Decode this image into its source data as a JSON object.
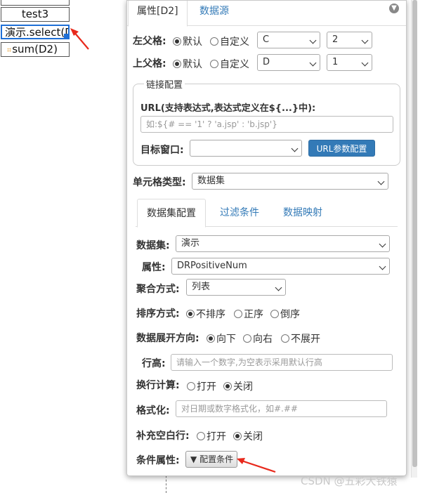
{
  "sheet": {
    "cells": [
      "test3",
      "演示.select(D",
      "sum(D2)"
    ],
    "sum_icon": "⌗"
  },
  "panel": {
    "tabs": [
      "属性[D2]",
      "数据源"
    ],
    "left_parent": {
      "label": "左父格:",
      "options": [
        "默认",
        "自定义"
      ],
      "selected": "默认",
      "col_value": "C",
      "row_value": "2"
    },
    "top_parent": {
      "label": "上父格:",
      "options": [
        "默认",
        "自定义"
      ],
      "selected": "默认",
      "col_value": "D",
      "row_value": "1"
    },
    "link": {
      "legend": "链接配置",
      "url_label": "URL(支持表达式,表达式定义在${...}中):",
      "url_placeholder": "如:${# == '1' ? 'a.jsp' : 'b.jsp'}",
      "target_label": "目标窗口:",
      "target_value": "",
      "param_button": "URL参数配置"
    },
    "cell_type": {
      "label": "单元格类型:",
      "value": "数据集"
    },
    "inner_tabs": [
      "数据集配置",
      "过滤条件",
      "数据映射"
    ],
    "dataset": {
      "label": "数据集:",
      "value": "演示"
    },
    "attribute": {
      "label": "属性:",
      "value": "DRPositiveNum"
    },
    "aggregate": {
      "label": "聚合方式:",
      "value": "列表"
    },
    "sort": {
      "label": "排序方式:",
      "options": [
        "不排序",
        "正序",
        "倒序"
      ],
      "selected": "不排序"
    },
    "expand": {
      "label": "数据展开方向:",
      "options": [
        "向下",
        "向右",
        "不展开"
      ],
      "selected": "向下"
    },
    "row_height": {
      "label": "行高:",
      "placeholder": "请输入一个数字,为空表示采用默认行高"
    },
    "wrap_calc": {
      "label": "换行计算:",
      "options": [
        "打开",
        "关闭"
      ],
      "selected": "关闭"
    },
    "format": {
      "label": "格式化:",
      "placeholder": "对日期或数字格式化，如#.##"
    },
    "fill_blank": {
      "label": "补充空白行:",
      "options": [
        "打开",
        "关闭"
      ],
      "selected": "关闭"
    },
    "condition": {
      "label": "条件属性:",
      "button": "配置条件"
    }
  },
  "watermark": "CSDN @五彩大铁猿",
  "colors": {
    "accent": "#337ab7",
    "arrow": "#e8291c",
    "cell_selected_border": "#1f6fd6"
  }
}
